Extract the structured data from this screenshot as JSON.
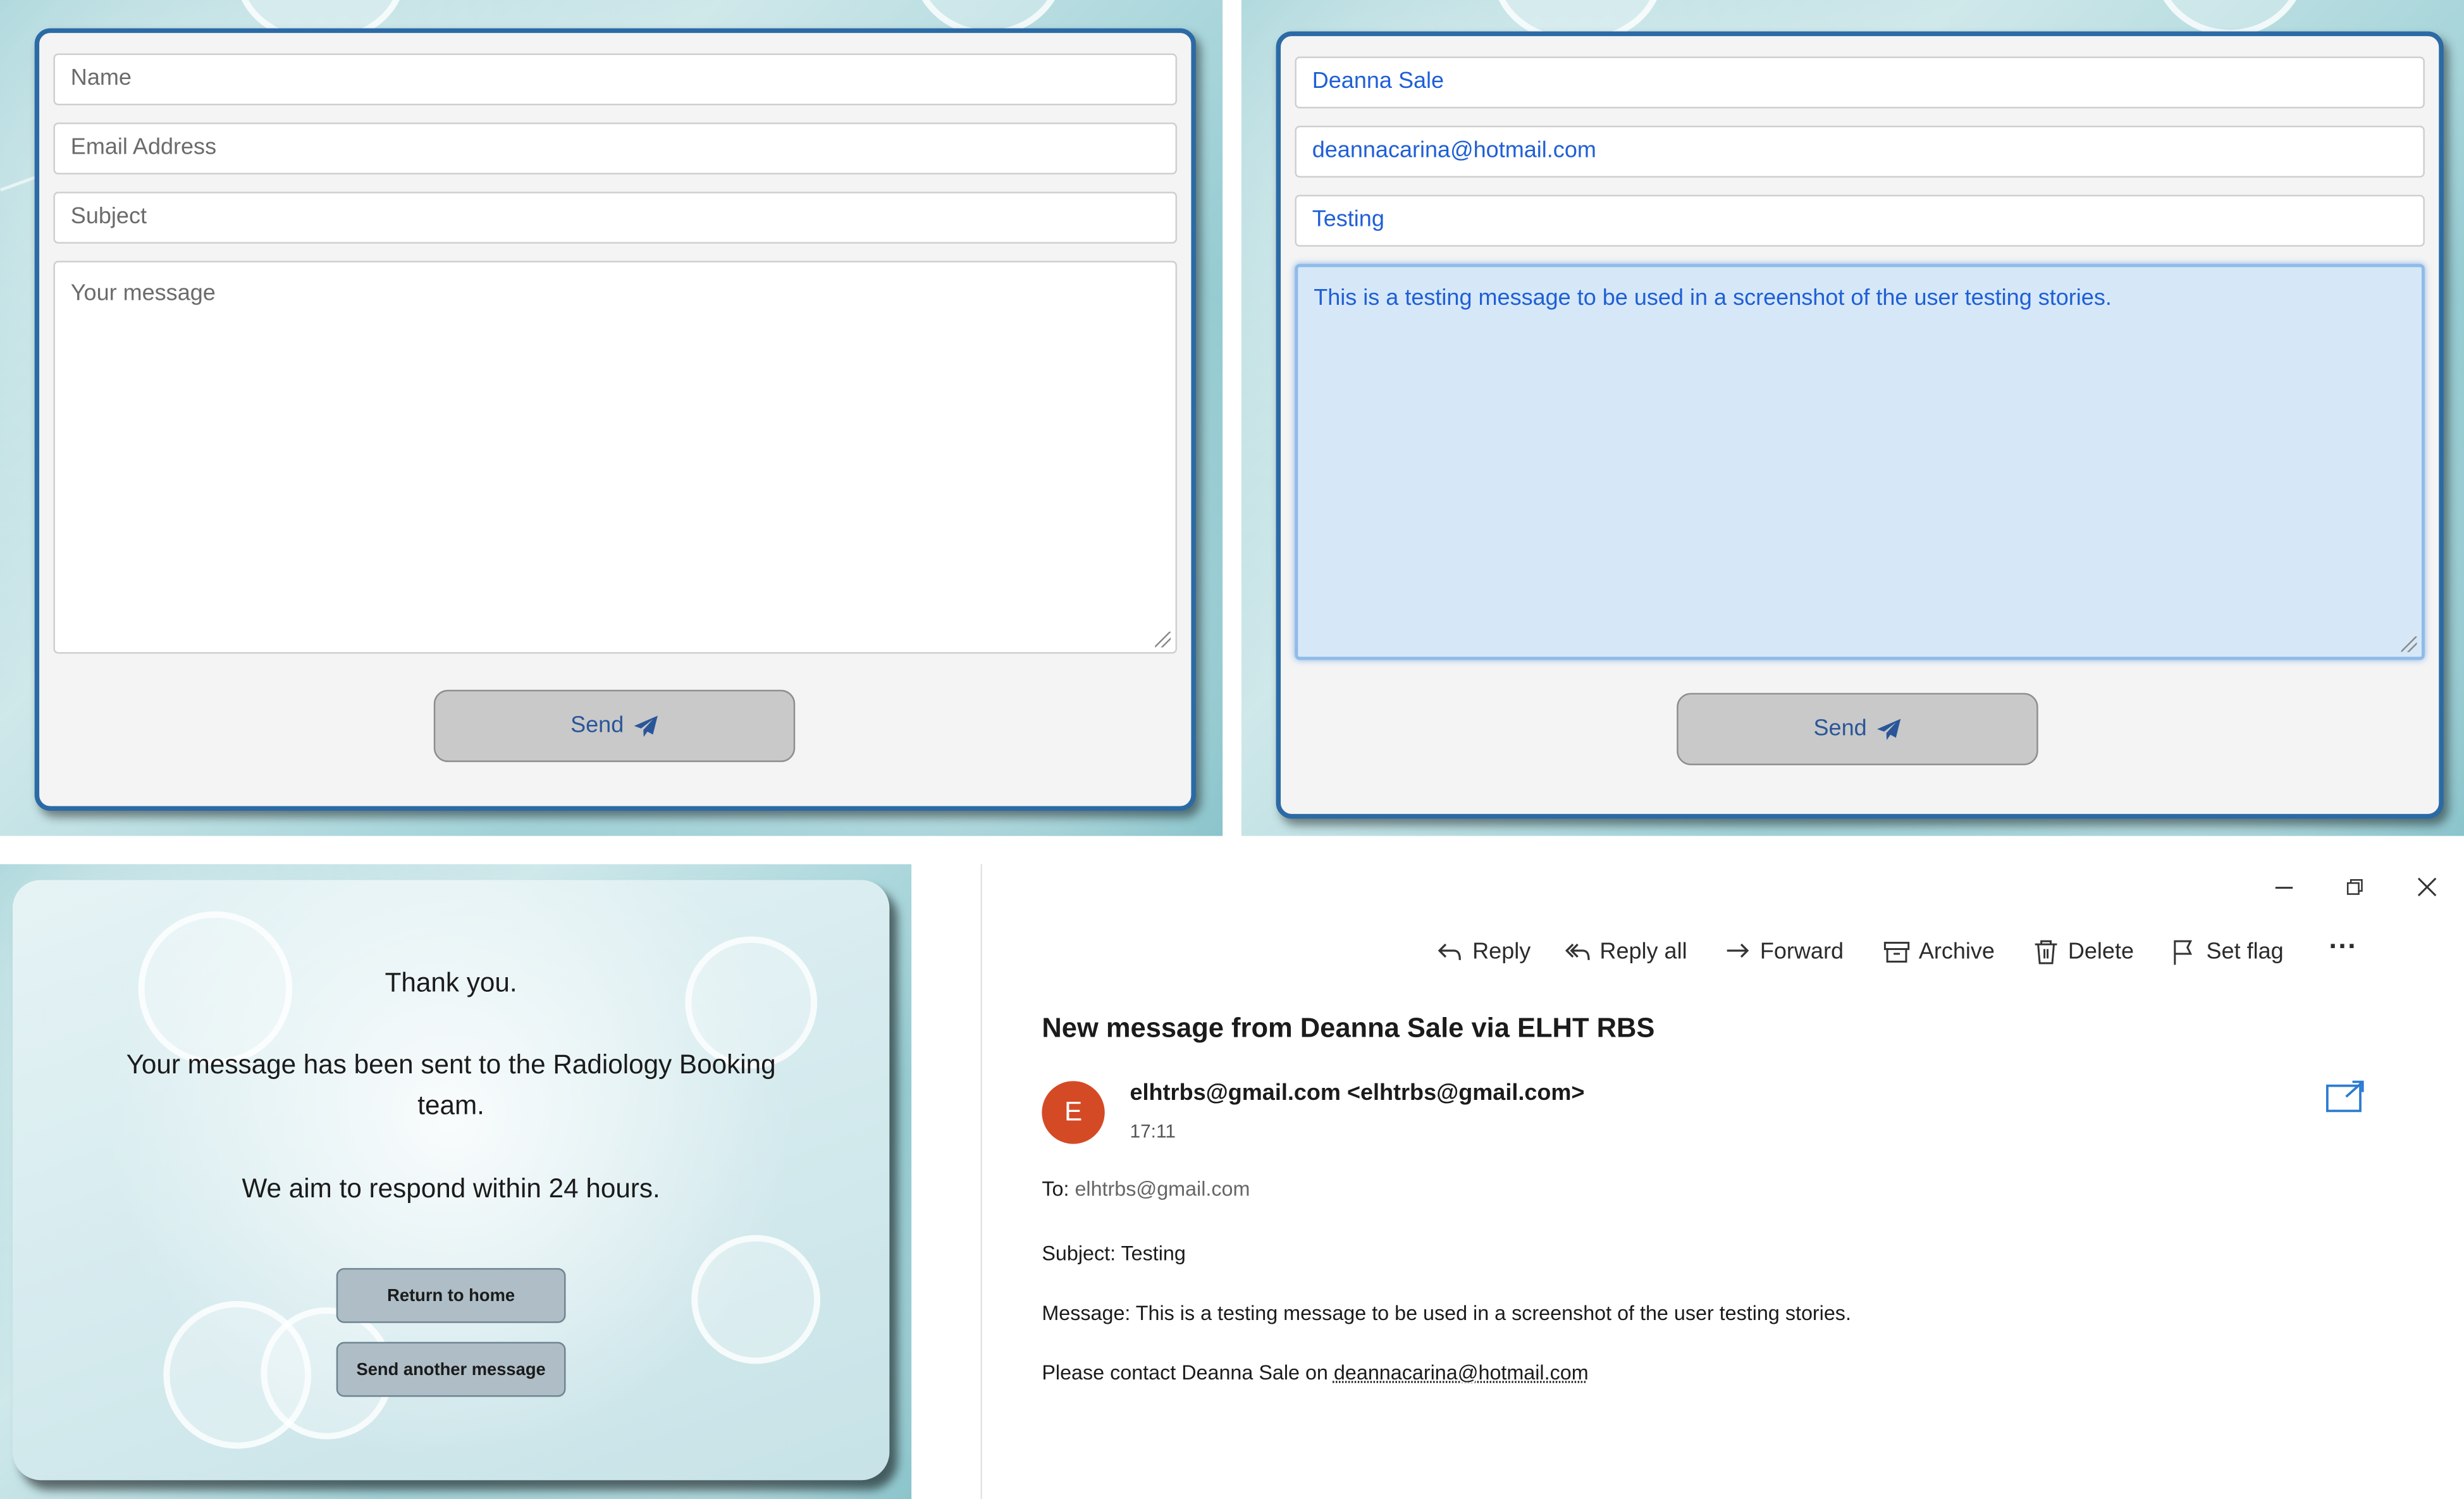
{
  "empty_form": {
    "name_placeholder": "Name",
    "email_placeholder": "Email Address",
    "subject_placeholder": "Subject",
    "message_placeholder": "Your message",
    "send_label": "Send"
  },
  "filled_form": {
    "name_value": "Deanna Sale",
    "email_value": "deannacarina@hotmail.com",
    "subject_value": "Testing",
    "message_value": "This is a testing message to be used in a screenshot of the user testing stories.",
    "send_label": "Send"
  },
  "confirmation": {
    "thank_you": "Thank you.",
    "sent_message": "Your message has been sent to the Radiology Booking team.",
    "response_time": "We aim to respond within 24 hours.",
    "return_home_label": "Return to home",
    "send_another_label": "Send another message"
  },
  "mail": {
    "toolbar": {
      "reply": "Reply",
      "reply_all": "Reply all",
      "forward": "Forward",
      "archive": "Archive",
      "delete": "Delete",
      "set_flag": "Set flag",
      "more": "···"
    },
    "subject_heading": "New message from Deanna Sale via ELHT RBS",
    "avatar_letter": "E",
    "from": "elhtrbs@gmail.com <elhtrbs@gmail.com>",
    "time": "17:11",
    "to_label": "To:",
    "to_value": "elhtrbs@gmail.com",
    "body_subject": "Subject: Testing",
    "body_message": "Message: This is a testing message to be used in a screenshot of the user testing stories.",
    "contact_prefix": "Please contact Deanna Sale on",
    "contact_email": "deannacarina@hotmail.com"
  },
  "colors": {
    "card_border": "#2b6aa5",
    "filled_text": "#1f5fd6",
    "avatar_bg": "#d44a25"
  }
}
